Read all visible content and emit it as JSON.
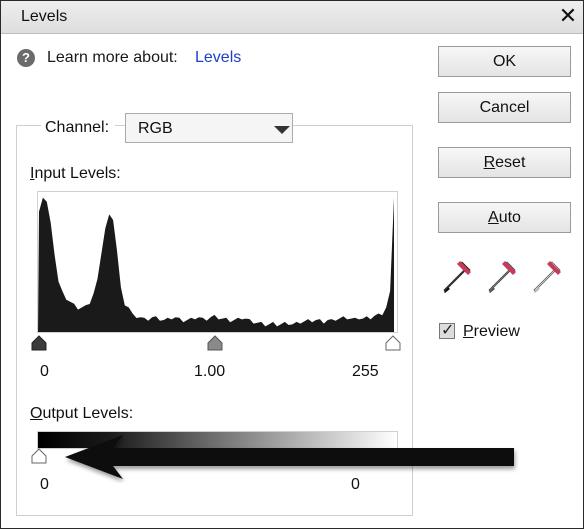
{
  "window": {
    "title": "Levels",
    "close_glyph": "✕"
  },
  "help": {
    "icon": "question-icon",
    "icon_glyph": "?",
    "text": "Learn more about:",
    "link": "Levels"
  },
  "channel": {
    "label": "Channel:",
    "value": "RGB"
  },
  "input_levels": {
    "label": "Input Levels:",
    "black": "0",
    "gamma": "1.00",
    "white": "255",
    "histogram_profile": [
      0.86,
      0.96,
      0.93,
      0.78,
      0.55,
      0.36,
      0.28,
      0.24,
      0.21,
      0.19,
      0.17,
      0.17,
      0.18,
      0.21,
      0.27,
      0.38,
      0.56,
      0.74,
      0.84,
      0.8,
      0.58,
      0.32,
      0.2,
      0.17,
      0.12,
      0.11,
      0.1,
      0.09,
      0.09,
      0.1,
      0.1,
      0.09,
      0.08,
      0.09,
      0.1,
      0.1,
      0.09,
      0.08,
      0.08,
      0.09,
      0.1,
      0.1,
      0.09,
      0.09,
      0.1,
      0.11,
      0.1,
      0.09,
      0.09,
      0.08,
      0.08,
      0.09,
      0.1,
      0.09,
      0.08,
      0.07,
      0.06,
      0.06,
      0.05,
      0.05,
      0.06,
      0.05,
      0.05,
      0.06,
      0.06,
      0.05,
      0.06,
      0.07,
      0.07,
      0.08,
      0.08,
      0.08,
      0.08,
      0.07,
      0.08,
      0.08,
      0.09,
      0.09,
      0.1,
      0.1,
      0.09,
      0.09,
      0.1,
      0.09,
      0.1,
      0.1,
      0.11,
      0.12,
      0.13,
      0.17,
      0.28,
      0.96
    ]
  },
  "output_levels": {
    "label": "Output Levels:",
    "black": "0",
    "white": "0"
  },
  "buttons": {
    "ok": "OK",
    "cancel": "Cancel",
    "reset": "Reset",
    "auto": "Auto"
  },
  "tools": [
    "black-eyedropper-icon",
    "gray-eyedropper-icon",
    "white-eyedropper-icon"
  ],
  "preview": {
    "label": "Preview",
    "checked": true
  },
  "colors": {
    "link": "#1e3fc6",
    "dropper_tip": "#c63a5a"
  }
}
